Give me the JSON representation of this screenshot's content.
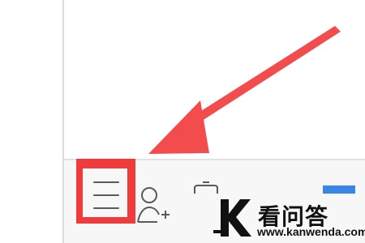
{
  "colors": {
    "highlight": "#ef3b3b",
    "arrow": "#f24c4c",
    "accent": "#3a86e8",
    "toolbar_bg": "#f7f7f7",
    "icon": "#5a5a5a"
  },
  "toolbar": {
    "menu_icon": "hamburger-menu-icon",
    "add_contact_icon": "add-contact-icon",
    "tool_icon": "tool-icon"
  },
  "annotation": {
    "arrow_icon": "pointer-arrow-icon"
  },
  "watermark": {
    "logo": "kanwenda-logo",
    "title": "看问答",
    "url": "www.kanwenda.com"
  }
}
